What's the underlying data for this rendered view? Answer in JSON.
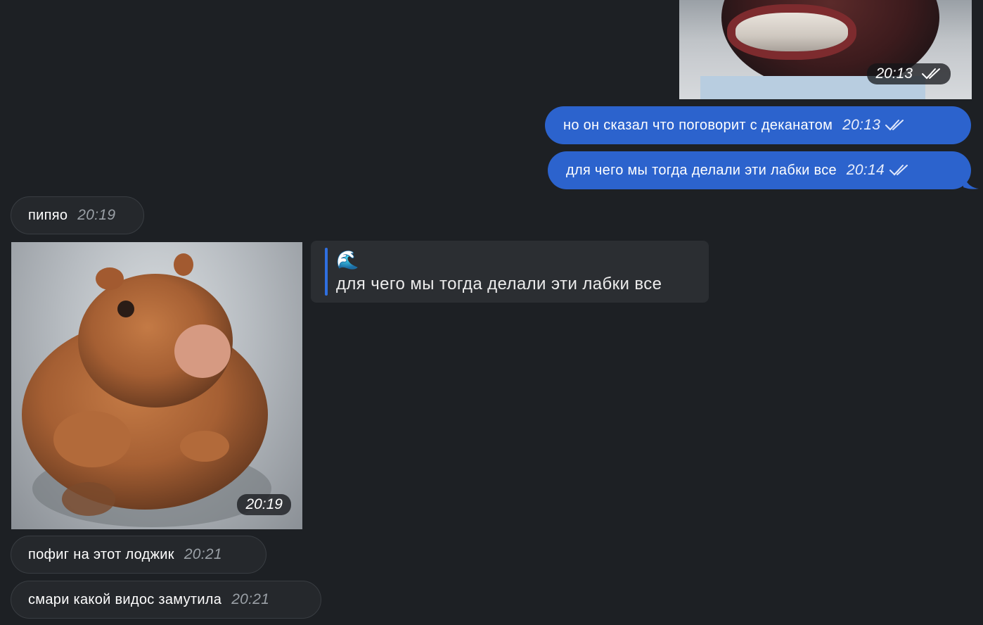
{
  "messages_top": {
    "image_time": "20:13",
    "bubble1": {
      "text": "но он сказал что поговорит с деканатом",
      "time": "20:13"
    },
    "bubble2": {
      "text": "для чего мы тогда делали эти лабки все",
      "time": "20:14"
    }
  },
  "incoming": {
    "msg1": {
      "text": "пипяо",
      "time": "20:19"
    },
    "photo_time": "20:19",
    "reply": {
      "emoji": "🌊",
      "text": "для чего мы тогда делали эти лабки все"
    },
    "msg2": {
      "text": "пофиг на этот лоджик",
      "time": "20:21"
    },
    "msg3": {
      "text": "смари какой видос замутила",
      "time": "20:21"
    }
  },
  "colors": {
    "background": "#1d2024",
    "outgoing_bubble": "#2c63cd",
    "incoming_bubble": "#25282c",
    "reply_accent": "#2f6fe0"
  },
  "icons": {
    "read_receipt": "double-check-icon"
  }
}
